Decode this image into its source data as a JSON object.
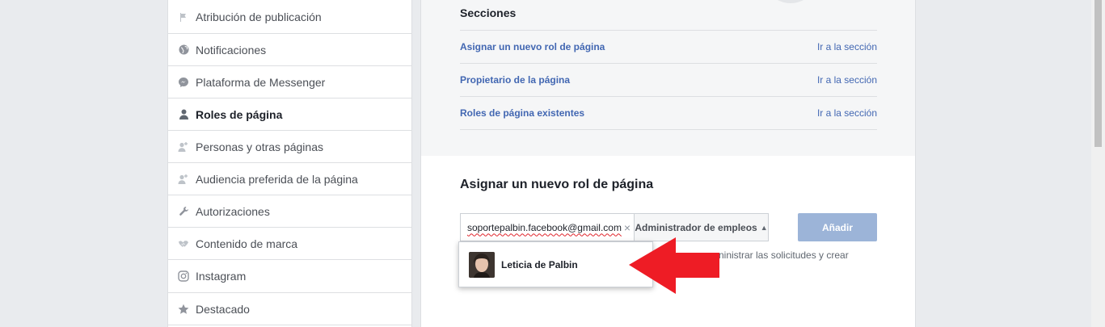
{
  "sidebar": {
    "items": [
      {
        "label": "Atribución de publicación",
        "icon": "flag-icon"
      },
      {
        "label": "Notificaciones",
        "icon": "globe-icon"
      },
      {
        "label": "Plataforma de Messenger",
        "icon": "messenger-icon"
      },
      {
        "label": "Roles de página",
        "icon": "person-icon",
        "active": true
      },
      {
        "label": "Personas y otras páginas",
        "icon": "person-add-icon"
      },
      {
        "label": "Audiencia preferida de la página",
        "icon": "person-add-icon"
      },
      {
        "label": "Autorizaciones",
        "icon": "wrench-icon"
      },
      {
        "label": "Contenido de marca",
        "icon": "handshake-icon"
      },
      {
        "label": "Instagram",
        "icon": "instagram-icon"
      },
      {
        "label": "Destacado",
        "icon": "star-icon"
      }
    ]
  },
  "sections": {
    "title": "Secciones",
    "rows": [
      {
        "label": "Asignar un nuevo rol de página",
        "link": "Ir a la sección"
      },
      {
        "label": "Propietario de la página",
        "link": "Ir a la sección"
      },
      {
        "label": "Roles de página existentes",
        "link": "Ir a la sección"
      }
    ]
  },
  "assign": {
    "title": "Asignar un nuevo rol de página",
    "input_value": "soportepalbin.facebook@gmail.com",
    "role_select": "Administrador de empleos",
    "add_button": "Añadir",
    "helper_text": "ninistrar las solicitudes y crear"
  },
  "typeahead": {
    "suggestion_name": "Leticia de Palbin"
  },
  "colors": {
    "link": "#4267b2",
    "button_disabled": "#9cb4d8",
    "arrow": "#ee1c25",
    "background": "#e9ebee"
  }
}
